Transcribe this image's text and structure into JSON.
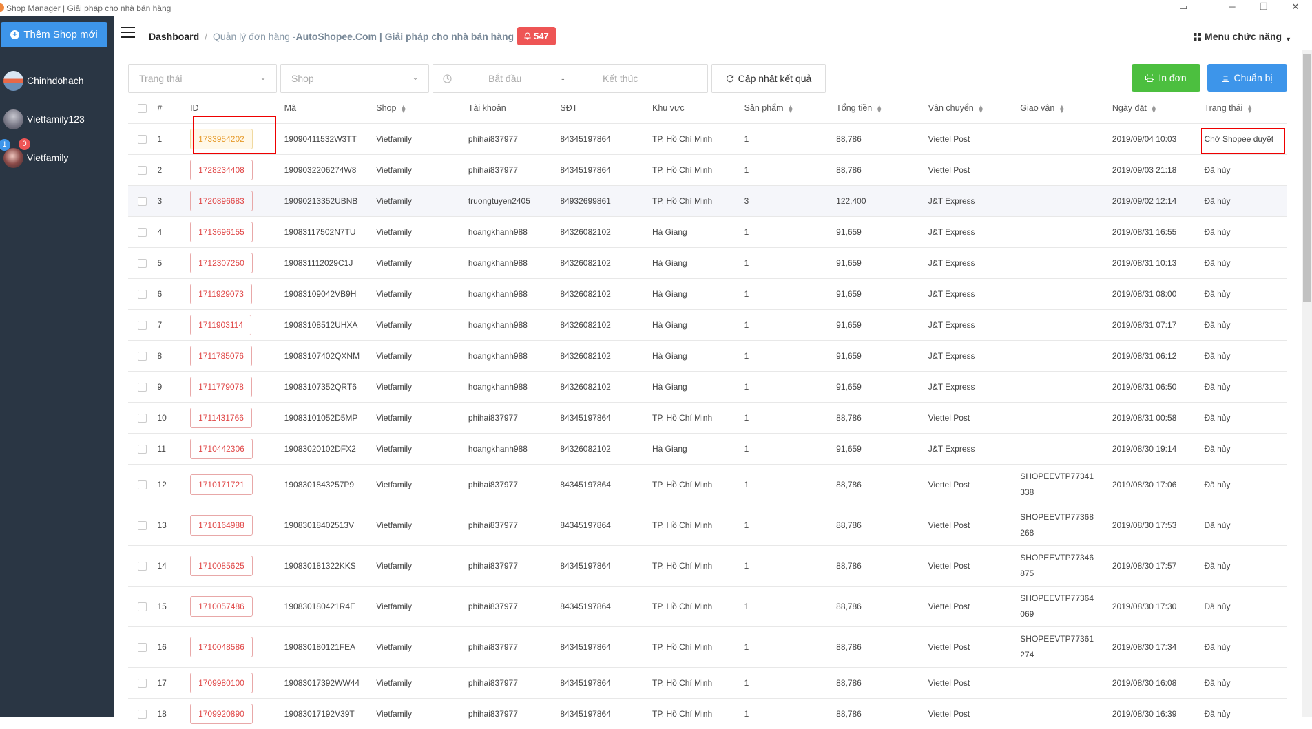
{
  "window": {
    "title": "Shop Manager | Giải pháp cho nhà bán hàng",
    "controls": [
      "▭",
      "─",
      "❐",
      "✕"
    ]
  },
  "sidebar": {
    "add_shop_label": "Thêm Shop mới",
    "shops": [
      {
        "name": "Chinhdohach"
      },
      {
        "name": "Vietfamily123"
      },
      {
        "name": "Vietfamily"
      }
    ],
    "badges": {
      "blue": "1",
      "red": "0"
    }
  },
  "topbar": {
    "breadcrumb_home": "Dashboard",
    "breadcrumb_sep": "/",
    "breadcrumb_page": "Quản lý đơn hàng - ",
    "breadcrumb_site": "AutoShopee.Com | Giải pháp cho nhà bán hàng",
    "notification_count": "547",
    "menu_label": "Menu chức năng"
  },
  "filters": {
    "status_placeholder": "Trạng thái",
    "shop_placeholder": "Shop",
    "start_placeholder": "Bắt đầu",
    "range_sep": "-",
    "end_placeholder": "Kết thúc",
    "refresh_label": "Cập nhật kết quả",
    "print_label": "In đơn",
    "prepare_label": "Chuẩn bị"
  },
  "colors": {
    "primary": "#3d95ea",
    "success": "#4cbf3f",
    "danger": "#ee5555",
    "sidebar": "#2a3644"
  },
  "table": {
    "headers": [
      "#",
      "ID",
      "Mã",
      "Shop",
      "Tài khoản",
      "SĐT",
      "Khu vực",
      "Sản phẩm",
      "Tổng tiền",
      "Vận chuyển",
      "Giao vận",
      "Ngày đặt",
      "Trạng thái"
    ],
    "rows": [
      {
        "n": "1",
        "id": "1733954202",
        "ma": "19090411532W3TT",
        "shop": "Vietfamily",
        "acc": "phihai837977",
        "phone": "84345197864",
        "area": "TP. Hồ Chí Minh",
        "qty": "1",
        "total": "88,786",
        "ship": "Viettel Post",
        "gv1": "",
        "gv2": "",
        "date": "2019/09/04 10:03",
        "status": "Chờ Shopee duyệt"
      },
      {
        "n": "2",
        "id": "1728234408",
        "ma": "1909032206274W8",
        "shop": "Vietfamily",
        "acc": "phihai837977",
        "phone": "84345197864",
        "area": "TP. Hồ Chí Minh",
        "qty": "1",
        "total": "88,786",
        "ship": "Viettel Post",
        "gv1": "",
        "gv2": "",
        "date": "2019/09/03 21:18",
        "status": "Đã hủy"
      },
      {
        "n": "3",
        "id": "1720896683",
        "ma": "19090213352UBNB",
        "shop": "Vietfamily",
        "acc": "truongtuyen2405",
        "phone": "84932699861",
        "area": "TP. Hồ Chí Minh",
        "qty": "3",
        "total": "122,400",
        "ship": "J&T Express",
        "gv1": "",
        "gv2": "",
        "date": "2019/09/02 12:14",
        "status": "Đã hủy"
      },
      {
        "n": "4",
        "id": "1713696155",
        "ma": "19083117502N7TU",
        "shop": "Vietfamily",
        "acc": "hoangkhanh988",
        "phone": "84326082102",
        "area": "Hà Giang",
        "qty": "1",
        "total": "91,659",
        "ship": "J&T Express",
        "gv1": "",
        "gv2": "",
        "date": "2019/08/31 16:55",
        "status": "Đã hủy"
      },
      {
        "n": "5",
        "id": "1712307250",
        "ma": "190831112029C1J",
        "shop": "Vietfamily",
        "acc": "hoangkhanh988",
        "phone": "84326082102",
        "area": "Hà Giang",
        "qty": "1",
        "total": "91,659",
        "ship": "J&T Express",
        "gv1": "",
        "gv2": "",
        "date": "2019/08/31 10:13",
        "status": "Đã hủy"
      },
      {
        "n": "6",
        "id": "1711929073",
        "ma": "19083109042VB9H",
        "shop": "Vietfamily",
        "acc": "hoangkhanh988",
        "phone": "84326082102",
        "area": "Hà Giang",
        "qty": "1",
        "total": "91,659",
        "ship": "J&T Express",
        "gv1": "",
        "gv2": "",
        "date": "2019/08/31 08:00",
        "status": "Đã hủy"
      },
      {
        "n": "7",
        "id": "1711903114",
        "ma": "19083108512UHXA",
        "shop": "Vietfamily",
        "acc": "hoangkhanh988",
        "phone": "84326082102",
        "area": "Hà Giang",
        "qty": "1",
        "total": "91,659",
        "ship": "J&T Express",
        "gv1": "",
        "gv2": "",
        "date": "2019/08/31 07:17",
        "status": "Đã hủy"
      },
      {
        "n": "8",
        "id": "1711785076",
        "ma": "19083107402QXNM",
        "shop": "Vietfamily",
        "acc": "hoangkhanh988",
        "phone": "84326082102",
        "area": "Hà Giang",
        "qty": "1",
        "total": "91,659",
        "ship": "J&T Express",
        "gv1": "",
        "gv2": "",
        "date": "2019/08/31 06:12",
        "status": "Đã hủy"
      },
      {
        "n": "9",
        "id": "1711779078",
        "ma": "19083107352QRT6",
        "shop": "Vietfamily",
        "acc": "hoangkhanh988",
        "phone": "84326082102",
        "area": "Hà Giang",
        "qty": "1",
        "total": "91,659",
        "ship": "J&T Express",
        "gv1": "",
        "gv2": "",
        "date": "2019/08/31 06:50",
        "status": "Đã hủy"
      },
      {
        "n": "10",
        "id": "1711431766",
        "ma": "19083101052D5MP",
        "shop": "Vietfamily",
        "acc": "phihai837977",
        "phone": "84345197864",
        "area": "TP. Hồ Chí Minh",
        "qty": "1",
        "total": "88,786",
        "ship": "Viettel Post",
        "gv1": "",
        "gv2": "",
        "date": "2019/08/31 00:58",
        "status": "Đã hủy"
      },
      {
        "n": "11",
        "id": "1710442306",
        "ma": "19083020102DFX2",
        "shop": "Vietfamily",
        "acc": "hoangkhanh988",
        "phone": "84326082102",
        "area": "Hà Giang",
        "qty": "1",
        "total": "91,659",
        "ship": "J&T Express",
        "gv1": "",
        "gv2": "",
        "date": "2019/08/30 19:14",
        "status": "Đã hủy"
      },
      {
        "n": "12",
        "id": "1710171721",
        "ma": "1908301843257P9",
        "shop": "Vietfamily",
        "acc": "phihai837977",
        "phone": "84345197864",
        "area": "TP. Hồ Chí Minh",
        "qty": "1",
        "total": "88,786",
        "ship": "Viettel Post",
        "gv1": "SHOPEEVTP77341",
        "gv2": "338",
        "date": "2019/08/30 17:06",
        "status": "Đã hủy"
      },
      {
        "n": "13",
        "id": "1710164988",
        "ma": "19083018402513V",
        "shop": "Vietfamily",
        "acc": "phihai837977",
        "phone": "84345197864",
        "area": "TP. Hồ Chí Minh",
        "qty": "1",
        "total": "88,786",
        "ship": "Viettel Post",
        "gv1": "SHOPEEVTP77368",
        "gv2": "268",
        "date": "2019/08/30 17:53",
        "status": "Đã hủy"
      },
      {
        "n": "14",
        "id": "1710085625",
        "ma": "190830181322KKS",
        "shop": "Vietfamily",
        "acc": "phihai837977",
        "phone": "84345197864",
        "area": "TP. Hồ Chí Minh",
        "qty": "1",
        "total": "88,786",
        "ship": "Viettel Post",
        "gv1": "SHOPEEVTP77346",
        "gv2": "875",
        "date": "2019/08/30 17:57",
        "status": "Đã hủy"
      },
      {
        "n": "15",
        "id": "1710057486",
        "ma": "190830180421R4E",
        "shop": "Vietfamily",
        "acc": "phihai837977",
        "phone": "84345197864",
        "area": "TP. Hồ Chí Minh",
        "qty": "1",
        "total": "88,786",
        "ship": "Viettel Post",
        "gv1": "SHOPEEVTP77364",
        "gv2": "069",
        "date": "2019/08/30 17:30",
        "status": "Đã hủy"
      },
      {
        "n": "16",
        "id": "1710048586",
        "ma": "190830180121FEA",
        "shop": "Vietfamily",
        "acc": "phihai837977",
        "phone": "84345197864",
        "area": "TP. Hồ Chí Minh",
        "qty": "1",
        "total": "88,786",
        "ship": "Viettel Post",
        "gv1": "SHOPEEVTP77361",
        "gv2": "274",
        "date": "2019/08/30 17:34",
        "status": "Đã hủy"
      },
      {
        "n": "17",
        "id": "1709980100",
        "ma": "19083017392WW44",
        "shop": "Vietfamily",
        "acc": "phihai837977",
        "phone": "84345197864",
        "area": "TP. Hồ Chí Minh",
        "qty": "1",
        "total": "88,786",
        "ship": "Viettel Post",
        "gv1": "",
        "gv2": "",
        "date": "2019/08/30 16:08",
        "status": "Đã hủy"
      },
      {
        "n": "18",
        "id": "1709920890",
        "ma": "19083017192V39T",
        "shop": "Vietfamily",
        "acc": "phihai837977",
        "phone": "84345197864",
        "area": "TP. Hồ Chí Minh",
        "qty": "1",
        "total": "88,786",
        "ship": "Viettel Post",
        "gv1": "",
        "gv2": "",
        "date": "2019/08/30 16:39",
        "status": "Đã hủy"
      }
    ]
  }
}
